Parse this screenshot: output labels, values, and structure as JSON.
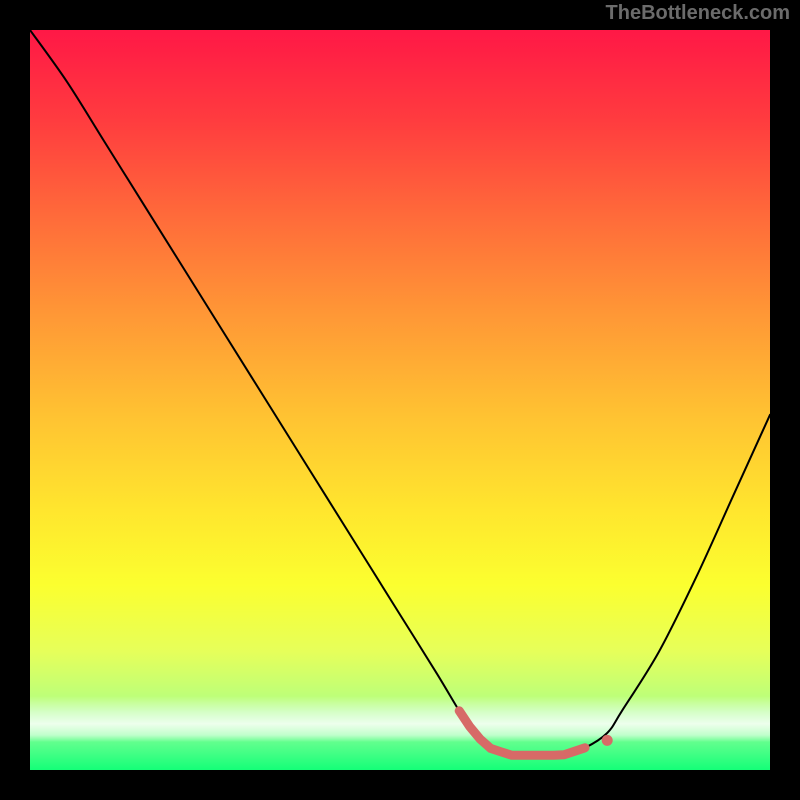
{
  "watermark": "TheBottleneck.com",
  "colors": {
    "background": "#000000",
    "curve": "#000000",
    "marker": "#d76a67",
    "gradient_top": "#ff1846",
    "gradient_bottom": "#14ff78"
  },
  "chart_data": {
    "type": "line",
    "title": "",
    "xlabel": "",
    "ylabel": "",
    "xlim": [
      0,
      100
    ],
    "ylim": [
      0,
      100
    ],
    "x": [
      0,
      5,
      10,
      15,
      20,
      25,
      30,
      35,
      40,
      45,
      50,
      55,
      58,
      60,
      62,
      65,
      68,
      72,
      75,
      78,
      80,
      85,
      90,
      95,
      100
    ],
    "values": [
      100,
      93,
      85,
      77,
      69,
      61,
      53,
      45,
      37,
      29,
      21,
      13,
      8,
      5,
      3,
      2,
      2,
      2,
      3,
      5,
      8,
      16,
      26,
      37,
      48
    ],
    "optimal_range_x": [
      58,
      75
    ],
    "optimal_marker_x": 75,
    "annotations": []
  }
}
